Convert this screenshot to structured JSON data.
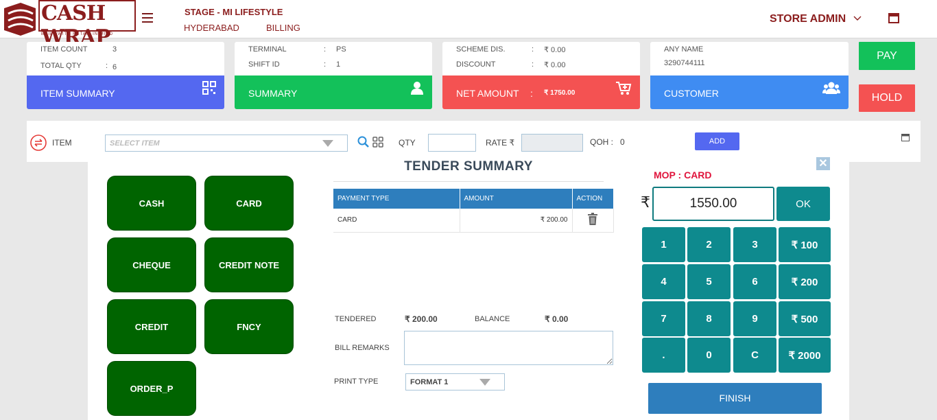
{
  "brand": {
    "name": "CASH WRAP",
    "tagline": "BUILT WITH RETAIL IN MIND"
  },
  "header": {
    "store": "STAGE - MI LIFESTYLE",
    "city": "HYDERABAD",
    "module": "BILLING",
    "user": "STORE ADMIN"
  },
  "cards": {
    "item_summary": {
      "item_count_label": "ITEM COUNT",
      "item_count": "3",
      "total_qty_label": "TOTAL QTY",
      "total_qty_sep": ":",
      "total_qty": "6",
      "title": "ITEM SUMMARY",
      "color": "#5468f0"
    },
    "summary": {
      "terminal_label": "TERMINAL",
      "terminal_sep": ":",
      "terminal": "PS",
      "shift_label": "SHIFT ID",
      "shift_sep": ":",
      "shift": "1",
      "title": "SUMMARY",
      "color": "#13c15a"
    },
    "net_amount": {
      "scheme_label": "SCHEME DIS.",
      "scheme_sep": ":",
      "scheme": "₹ 0.00",
      "discount_label": "DISCOUNT",
      "discount_sep": ":",
      "discount": "₹ 0.00",
      "title": "NET AMOUNT",
      "title_sep": ":",
      "amount": "₹ 1750.00",
      "color": "#f45252"
    },
    "customer": {
      "name": "ANY NAME",
      "phone": "3290744111",
      "title": "CUSTOMER",
      "color": "#3f8cf2"
    }
  },
  "actions": {
    "pay": "PAY",
    "hold": "HOLD"
  },
  "itembar": {
    "item_label": "ITEM",
    "select_placeholder": "SELECT ITEM",
    "qty_label": "QTY",
    "qty_value": "",
    "rate_label": "RATE ₹",
    "rate_value": "",
    "qoh_label": "QOH :",
    "qoh_value": "0",
    "add": "ADD"
  },
  "tender": {
    "title": "TENDER SUMMARY",
    "modes": [
      "CASH",
      "CARD",
      "CHEQUE",
      "CREDIT NOTE",
      "CREDIT",
      "FNCY",
      "ORDER_P"
    ],
    "table": {
      "headers": [
        "PAYMENT TYPE",
        "AMOUNT",
        "ACTION"
      ],
      "rows": [
        {
          "type": "CARD",
          "amount": "₹ 200.00"
        }
      ]
    },
    "tendered_label": "TENDERED",
    "tendered": "₹ 200.00",
    "balance_label": "BALANCE",
    "balance": "₹ 0.00",
    "remarks_label": "BILL REMARKS",
    "remarks_value": "",
    "print_label": "PRINT TYPE",
    "print_value": "FORMAT 1",
    "mop": "MOP : CARD",
    "currency": "₹",
    "amount_input": "1550.00",
    "ok": "OK",
    "keys": [
      "1",
      "2",
      "3",
      "₹ 100",
      "4",
      "5",
      "6",
      "₹ 200",
      "7",
      "8",
      "9",
      "₹ 500",
      ".",
      "0",
      "C",
      "₹ 2000"
    ],
    "finish": "FINISH"
  },
  "colors": {
    "brand_red": "#8b1d1d",
    "mode_green": "#006400",
    "key_teal": "#0e8a8e",
    "table_blue": "#2e7ebd",
    "pay_green": "#13c15a",
    "hold_red": "#f45252",
    "mop_red": "#e0143c"
  }
}
